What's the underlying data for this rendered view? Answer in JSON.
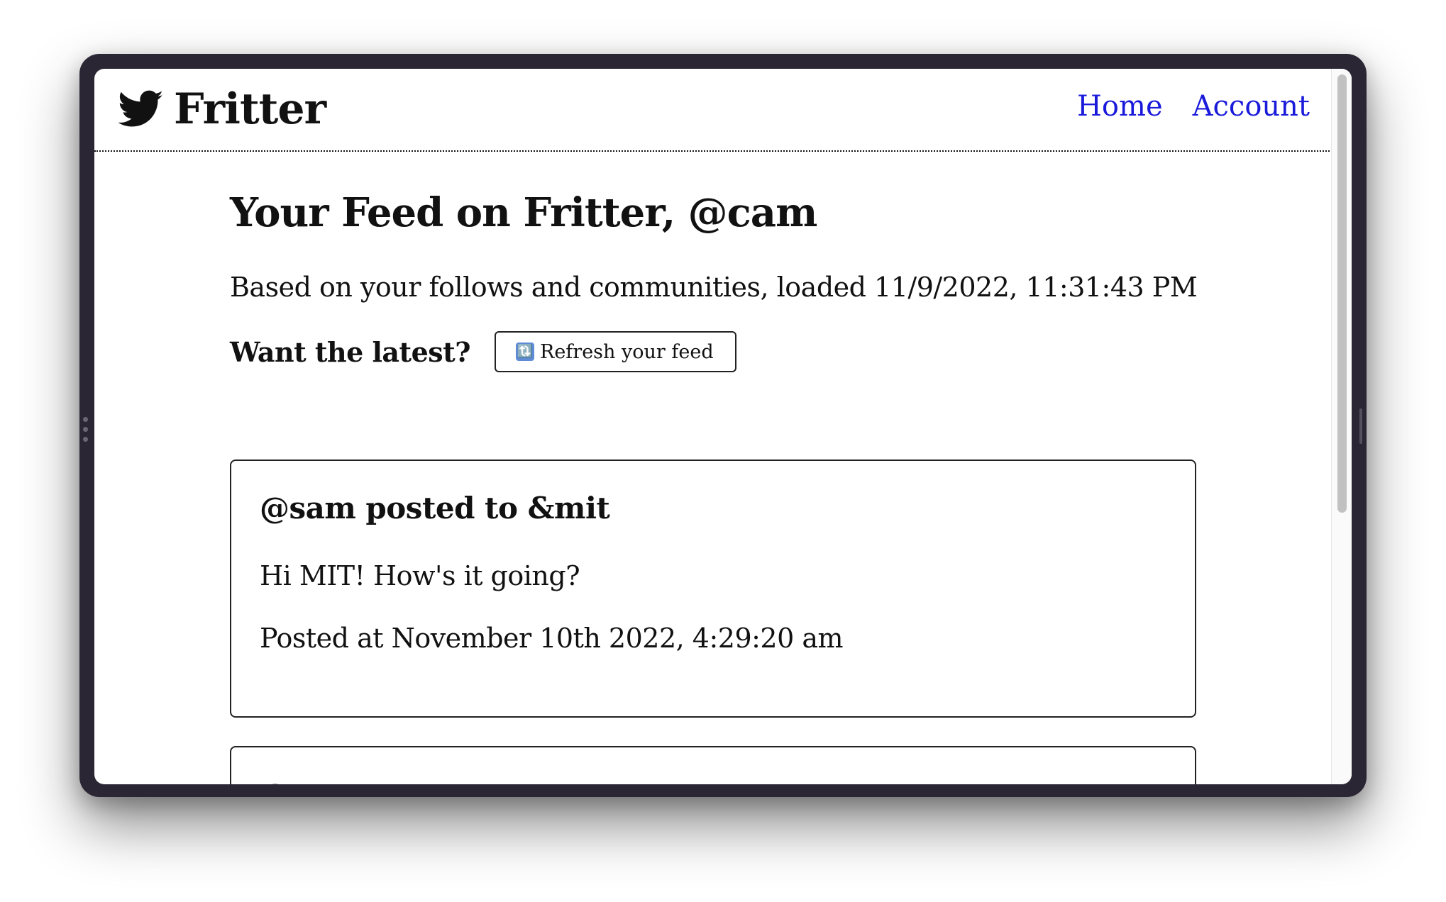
{
  "header": {
    "brand": "Fritter",
    "nav": [
      {
        "label": "Home"
      },
      {
        "label": "Account"
      }
    ]
  },
  "feed": {
    "title": "Your Feed on Fritter, @cam",
    "subtitle": "Based on your follows and communities, loaded 11/9/2022, 11:31:43 PM",
    "refresh_prompt": "Want the latest?",
    "refresh_button_label": "Refresh your feed",
    "refresh_icon": "🔃"
  },
  "posts": [
    {
      "header": "@sam posted to &mit",
      "content": "Hi MIT! How's it going?",
      "timestamp": "Posted at November 10th 2022, 4:29:20 am"
    },
    {
      "header": "@sam"
    }
  ],
  "colors": {
    "link": "#1a1adb",
    "device_frame": "#2b2634",
    "text": "#111111"
  }
}
